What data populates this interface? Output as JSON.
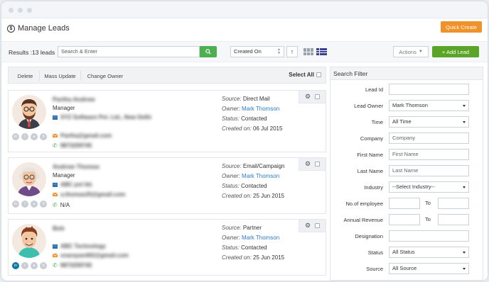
{
  "app": {
    "title": "Manage Leads",
    "quick_create": "Quick Create"
  },
  "toolbar": {
    "results": "Results :13 leads",
    "search_placeholder": "Search & Enter",
    "sort_value": "Created On",
    "actions_label": "Actions",
    "add_lead_label": "+ Add Lead"
  },
  "bulk": {
    "delete": "Delete",
    "mass_update": "Mass Update",
    "change_owner": "Change Owner",
    "select_all": "Select All"
  },
  "leads": [
    {
      "name": "Partha Andrew",
      "role": "Manager",
      "company": "SYZ Software Pvt. Ltd., New Delhi",
      "email": "Partha@gmail.com",
      "phone": "9873259745",
      "source": "Direct Mail",
      "owner": "Mark Thomson",
      "status": "Contacted",
      "created": "06 Jul 2015"
    },
    {
      "name": "Andrew Thomas",
      "role": "Manager",
      "company": "ABC pvt ltd.",
      "email": "a.thomas25@gmail.com",
      "phone": "N/A",
      "source": "Email/Campaign",
      "owner": "Mark Thomson",
      "status": "Contacted",
      "created": "25 Jun 2015"
    },
    {
      "name": "Bob",
      "role": "",
      "company": "ABC Technology",
      "email": "snarayan402@gmail.com",
      "phone": "9873259745",
      "source": "Partner",
      "owner": "Mark Thomson",
      "status": "Contacted",
      "created": "25 Jun 2015"
    }
  ],
  "meta_labels": {
    "source": "Source:",
    "owner": "Owner:",
    "status": "Status:",
    "created": "Created on:"
  },
  "search_filter": {
    "title": "Search Filter",
    "lead_id": "Lead Id",
    "lead_owner": "Lead Owner",
    "lead_owner_value": "Mark Thomson",
    "time": "Time",
    "time_value": "All Time",
    "company": "Company",
    "company_placeholder": "Company",
    "first_name": "First Name",
    "first_name_placeholder": "First Name",
    "last_name": "Last Name",
    "last_name_placeholder": "Last Name",
    "industry": "Industry",
    "industry_value": "--Select Industry--",
    "employees": "No.of employee",
    "annual_revenue": "Annual Revenue",
    "to": "To",
    "designation": "Designation",
    "status": "Status",
    "status_value": "All Status",
    "source": "Source",
    "source_value": "All Source"
  }
}
